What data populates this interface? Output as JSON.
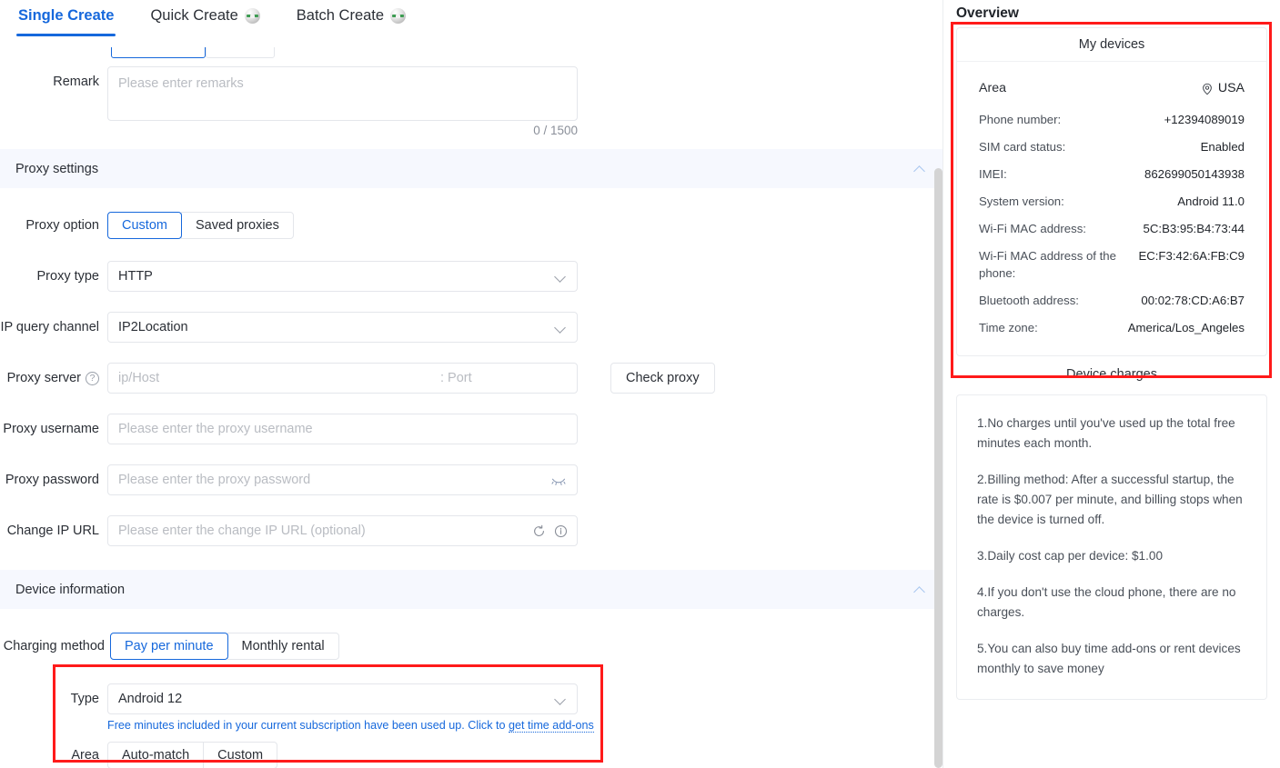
{
  "tabs": [
    {
      "label": "Single Create",
      "icon": null,
      "active": true
    },
    {
      "label": "Quick Create",
      "icon": "sphere-badge-icon",
      "active": false
    },
    {
      "label": "Batch Create",
      "icon": "sphere-badge-icon",
      "active": false
    }
  ],
  "remark": {
    "label": "Remark",
    "placeholder": "Please enter remarks",
    "value": "",
    "counter": "0 / 1500"
  },
  "proxy_settings": {
    "title": "Proxy settings",
    "collapse_icon": "chevron-up-icon",
    "proxy_option": {
      "label": "Proxy option",
      "options": [
        "Custom",
        "Saved proxies"
      ],
      "selected": "Custom"
    },
    "proxy_type": {
      "label": "Proxy type",
      "value": "HTTP"
    },
    "ip_query_channel": {
      "label": "IP query channel",
      "value": "IP2Location"
    },
    "proxy_server": {
      "label": "Proxy server",
      "help_icon": "question-circle-icon",
      "host_placeholder": "ip/Host",
      "port_placeholder": ": Port",
      "value": "",
      "check_button": "Check proxy"
    },
    "proxy_username": {
      "label": "Proxy username",
      "placeholder": "Please enter the proxy username",
      "value": ""
    },
    "proxy_password": {
      "label": "Proxy password",
      "placeholder": "Please enter the proxy password",
      "value": "",
      "toggle_icon": "eye-closed-icon"
    },
    "change_ip_url": {
      "label": "Change IP URL",
      "placeholder": "Please enter the change IP URL (optional)",
      "value": "",
      "refresh_icon": "refresh-icon",
      "info_icon": "info-circle-icon"
    }
  },
  "device_information": {
    "title": "Device information",
    "collapse_icon": "chevron-up-icon",
    "charging_method": {
      "label": "Charging method",
      "options": [
        "Pay per minute",
        "Monthly rental"
      ],
      "selected": "Pay per minute"
    },
    "type": {
      "label": "Type",
      "value": "Android 12"
    },
    "type_hint": {
      "text": "Free minutes included in your current subscription have been used up. Click to ",
      "link": "get time add-ons"
    },
    "area": {
      "label": "Area",
      "options": [
        "Auto-match",
        "Custom"
      ],
      "selected": null
    }
  },
  "overview": {
    "title": "Overview",
    "my_devices": {
      "title": "My devices",
      "area": {
        "label": "Area",
        "value": "USA",
        "icon": "location-pin-icon"
      },
      "rows": [
        {
          "label": "Phone number:",
          "value": "+12394089019"
        },
        {
          "label": "SIM card status:",
          "value": "Enabled"
        },
        {
          "label": "IMEI:",
          "value": "862699050143938"
        },
        {
          "label": "System version:",
          "value": "Android 11.0"
        },
        {
          "label": "Wi-Fi MAC address:",
          "value": "5C:B3:95:B4:73:44"
        },
        {
          "label": "Wi-Fi MAC address of the phone:",
          "value": "EC:F3:42:6A:FB:C9"
        },
        {
          "label": "Bluetooth address:",
          "value": "00:02:78:CD:A6:B7"
        },
        {
          "label": "Time zone:",
          "value": "America/Los_Angeles"
        }
      ]
    },
    "device_charges": {
      "title": "Device charges",
      "items": [
        "1.No charges until you've used up the total free minutes each month.",
        "2.Billing method: After a successful startup, the rate is $0.007 per minute, and billing stops when the device is turned off.",
        "3.Daily cost cap per device: $1.00",
        "4.If you don't use the cloud phone, there are no charges.",
        "5.You can also buy time add-ons or rent devices monthly to save money"
      ]
    }
  },
  "colors": {
    "accent": "#1668dc",
    "highlight": "#ff1a1a",
    "section_bg": "#f6f8fe"
  }
}
